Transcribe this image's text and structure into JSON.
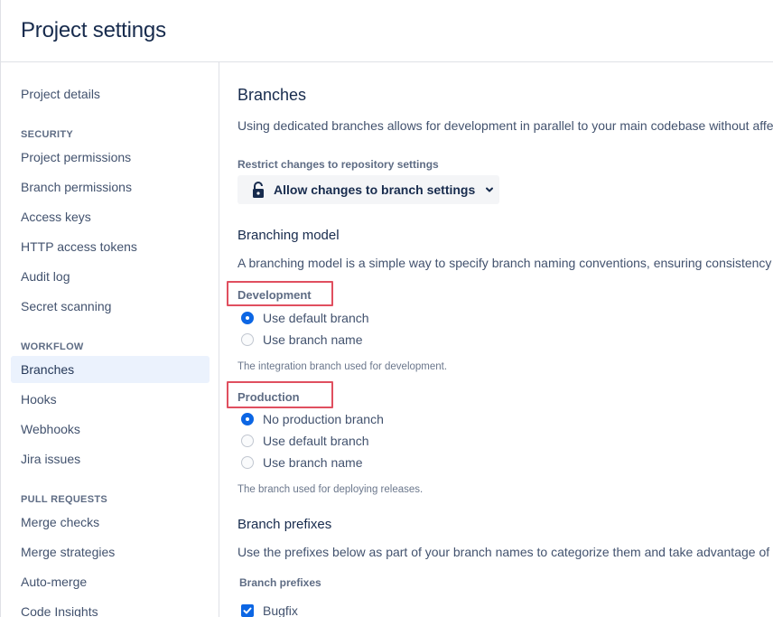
{
  "header": {
    "title": "Project settings"
  },
  "sidebar": {
    "items_top": [
      {
        "label": "Project details"
      }
    ],
    "sections": [
      {
        "title": "SECURITY",
        "items": [
          {
            "label": "Project permissions"
          },
          {
            "label": "Branch permissions"
          },
          {
            "label": "Access keys"
          },
          {
            "label": "HTTP access tokens"
          },
          {
            "label": "Audit log"
          },
          {
            "label": "Secret scanning"
          }
        ]
      },
      {
        "title": "WORKFLOW",
        "items": [
          {
            "label": "Branches",
            "active": true
          },
          {
            "label": "Hooks"
          },
          {
            "label": "Webhooks"
          },
          {
            "label": "Jira issues"
          }
        ]
      },
      {
        "title": "PULL REQUESTS",
        "items": [
          {
            "label": "Merge checks"
          },
          {
            "label": "Merge strategies"
          },
          {
            "label": "Auto-merge"
          },
          {
            "label": "Code Insights"
          }
        ]
      }
    ]
  },
  "main": {
    "title": "Branches",
    "intro": "Using dedicated branches allows for development in parallel to your main codebase without affe",
    "restrict": {
      "label": "Restrict changes to repository settings",
      "selected": "Allow changes to branch settings",
      "icon": "unlock-icon"
    },
    "branching_model": {
      "title": "Branching model",
      "description": "A branching model is a simple way to specify branch naming conventions, ensuring consistency f",
      "development": {
        "label": "Development",
        "options": [
          {
            "label": "Use default branch",
            "checked": true
          },
          {
            "label": "Use branch name",
            "checked": false
          }
        ],
        "helper": "The integration branch used for development."
      },
      "production": {
        "label": "Production",
        "options": [
          {
            "label": "No production branch",
            "checked": true
          },
          {
            "label": "Use default branch",
            "checked": false
          },
          {
            "label": "Use branch name",
            "checked": false
          }
        ],
        "helper": "The branch used for deploying releases."
      }
    },
    "prefixes": {
      "title": "Branch prefixes",
      "description": "Use the prefixes below as part of your branch names to categorize them and take advantage of a",
      "label": "Branch prefixes",
      "items": [
        {
          "label": "Bugfix",
          "checked": true
        }
      ]
    }
  },
  "colors": {
    "accent": "#0c66e4",
    "highlight": "#e04f5f",
    "active_bg": "#ebf2fd"
  }
}
